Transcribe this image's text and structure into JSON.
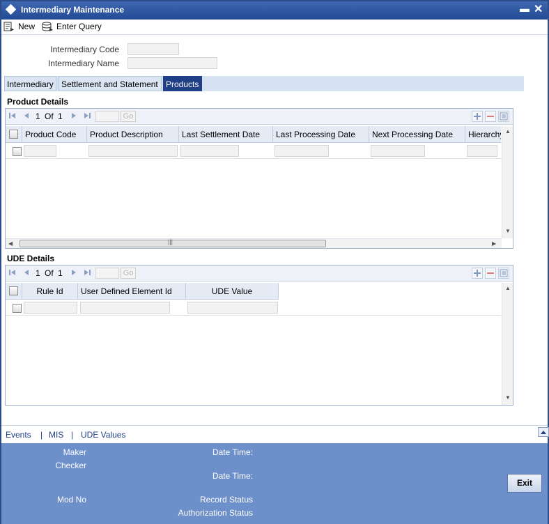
{
  "window": {
    "title": "Intermediary Maintenance",
    "minimize_glyph": "▬",
    "close_glyph": "✕"
  },
  "toolbar": {
    "new_label": "New",
    "enter_query_label": "Enter Query"
  },
  "header": {
    "code_label": "Intermediary Code",
    "code_value": "",
    "name_label": "Intermediary Name",
    "name_value": ""
  },
  "tabs": [
    {
      "label": "Intermediary",
      "active": false
    },
    {
      "label": "Settlement and Statement",
      "active": false
    },
    {
      "label": "Products",
      "active": true
    }
  ],
  "product_details": {
    "title": "Product Details",
    "pager": {
      "current": "1",
      "of_label": "Of",
      "total": "1",
      "go_label": "Go"
    },
    "columns": [
      "Product Code",
      "Product Description",
      "Last Settlement Date",
      "Last Processing Date",
      "Next Processing Date",
      "Hierarchy"
    ],
    "rows": [
      {
        "product_code": "",
        "product_description": "",
        "last_settlement_date": "",
        "last_processing_date": "",
        "next_processing_date": "",
        "hierarchy": ""
      }
    ]
  },
  "ude_details": {
    "title": "UDE Details",
    "pager": {
      "current": "1",
      "of_label": "Of",
      "total": "1",
      "go_label": "Go"
    },
    "columns": [
      "Rule Id",
      "User Defined Element Id",
      "UDE Value"
    ],
    "rows": [
      {
        "rule_id": "",
        "user_defined_element_id": "",
        "ude_value": ""
      }
    ]
  },
  "footer_links": {
    "events": "Events",
    "mis": "MIS",
    "ude_values": "UDE Values",
    "separator": "|"
  },
  "audit": {
    "maker_label": "Maker",
    "checker_label": "Checker",
    "date_time_label": "Date Time:",
    "date_time_label_2": "Date Time:",
    "mod_no_label": "Mod No",
    "record_status_label": "Record Status",
    "authorization_status_label": "Authorization Status"
  },
  "exit_label": "Exit",
  "colors": {
    "title_bar": "#234a94",
    "active_tab": "#1f3f86",
    "audit_panel": "#6d8fca",
    "link": "#1f3f86"
  }
}
